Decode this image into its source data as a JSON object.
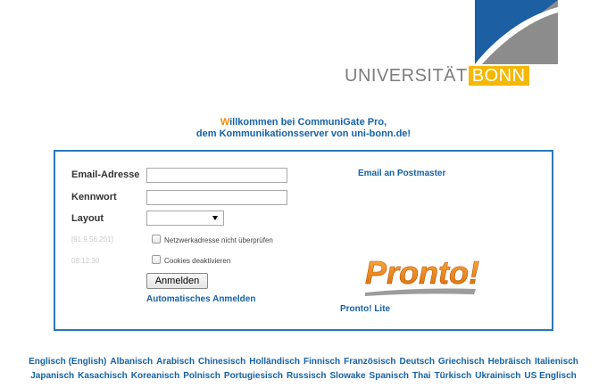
{
  "logo": {
    "text_main": "UNIVERSITÄT",
    "text_box": "BONN",
    "colors": {
      "blue": "#1c5fa3",
      "gray": "#8c8c8c",
      "yellow": "#f5b800"
    }
  },
  "welcome": {
    "first_letter": "W",
    "line1_rest": "illkommen bei CommuniGate Pro,",
    "line2": "dem Kommunikationsserver von uni-bonn.de!"
  },
  "login": {
    "email_label": "Email-Adresse",
    "email_value": "",
    "password_label": "Kennwort",
    "password_value": "",
    "layout_label": "Layout",
    "layout_value": "",
    "ip_address": "[91.9.56.201]",
    "time": "08:12:30",
    "checkbox_network_label": "Netzwerkadresse nicht überprüfen",
    "checkbox_cookies_label": "Cookies deaktivieren",
    "submit_label": "Anmelden",
    "auto_login_link": "Automatisches Anmelden",
    "postmaster_link": "Email an Postmaster",
    "pronto_logo_text": "Pronto!",
    "pronto_lite_link": "Pronto! Lite"
  },
  "languages": {
    "row1": [
      "Englisch (English)",
      "Albanisch",
      "Arabisch",
      "Chinesisch",
      "Holländisch",
      "Finnisch",
      "Französisch",
      "Deutsch",
      "Griechisch",
      "Hebräisch",
      "Italienisch"
    ],
    "row2": [
      "Japanisch",
      "Kasachisch",
      "Koreanisch",
      "Polnisch",
      "Portugiesisch",
      "Russisch",
      "Slowake",
      "Spanisch",
      "Thai",
      "Türkisch",
      "Ukrainisch",
      "US Englisch"
    ]
  }
}
